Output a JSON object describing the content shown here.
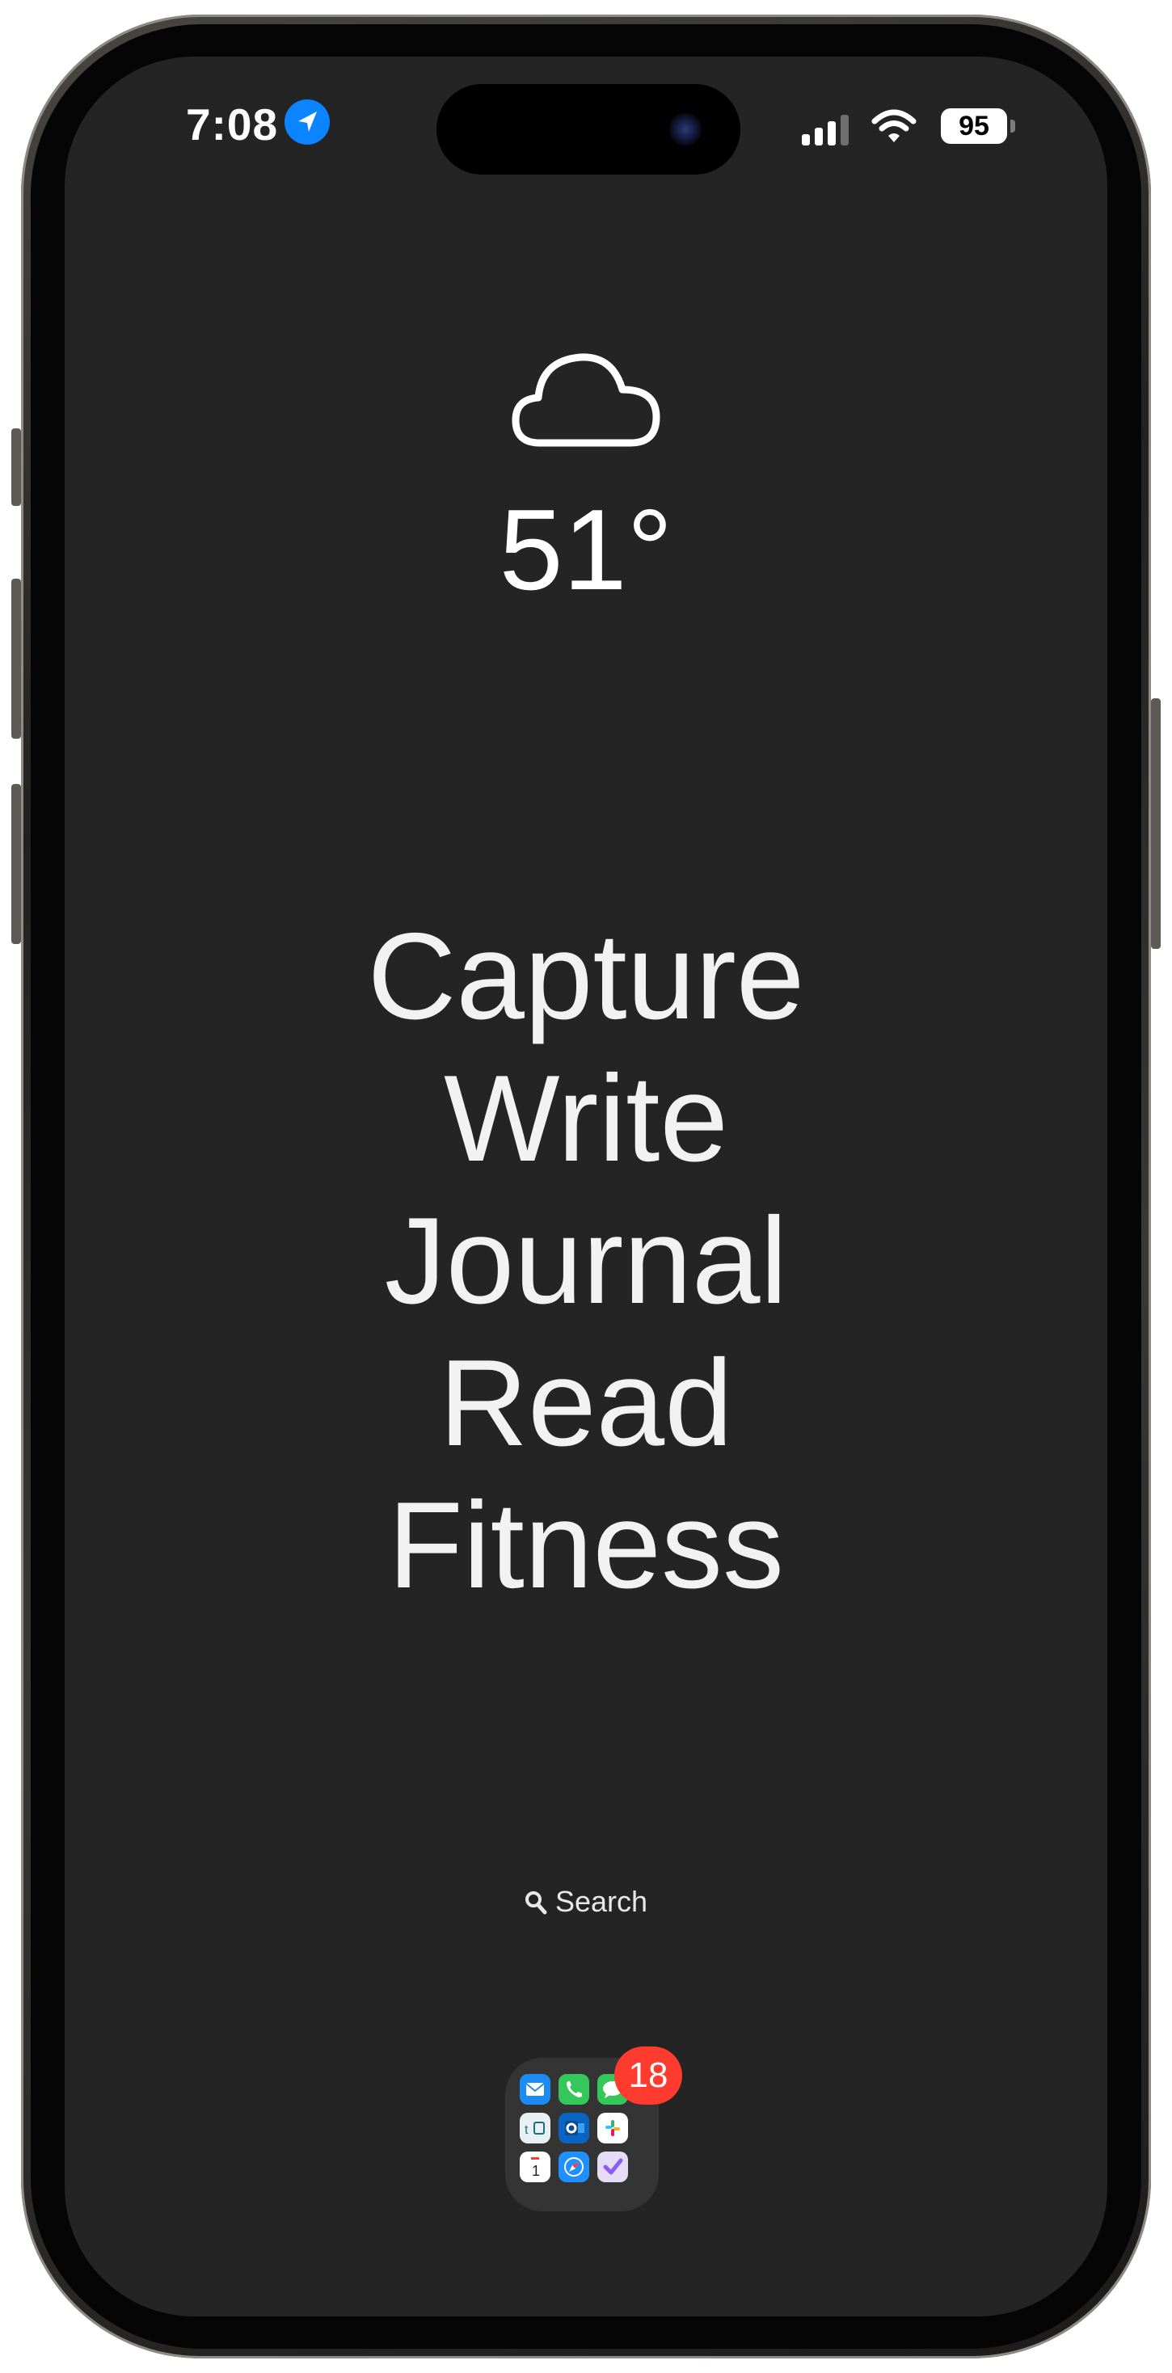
{
  "status_bar": {
    "time": "7:08",
    "battery": "95",
    "signal_bars": 3,
    "accent_color": "#0a84ff"
  },
  "weather": {
    "icon": "cloud-icon",
    "temperature": "51°"
  },
  "shortcuts": [
    {
      "label": "Capture"
    },
    {
      "label": "Write"
    },
    {
      "label": "Journal"
    },
    {
      "label": "Read"
    },
    {
      "label": "Fitness"
    }
  ],
  "search": {
    "label": "Search",
    "icon": "magnifier-icon"
  },
  "dock": {
    "folder_badge": "18",
    "badge_color": "#ff3b30",
    "folder_apps": [
      {
        "icon": "mail-icon",
        "color": "#1a8cf4"
      },
      {
        "icon": "phone-icon",
        "color": "#34c759"
      },
      {
        "icon": "messages-icon",
        "color": "#34c759"
      },
      {
        "icon": "tasks-icon",
        "color": "#e8f0f4"
      },
      {
        "icon": "outlook-icon",
        "color": "#0a64c4"
      },
      {
        "icon": "slack-icon",
        "color": "#ffffff"
      },
      {
        "icon": "calendar-icon",
        "color": "#ffffff"
      },
      {
        "icon": "safari-icon",
        "color": "#1e90ff"
      },
      {
        "icon": "checklist-icon",
        "color": "#e6dcf6"
      }
    ]
  }
}
